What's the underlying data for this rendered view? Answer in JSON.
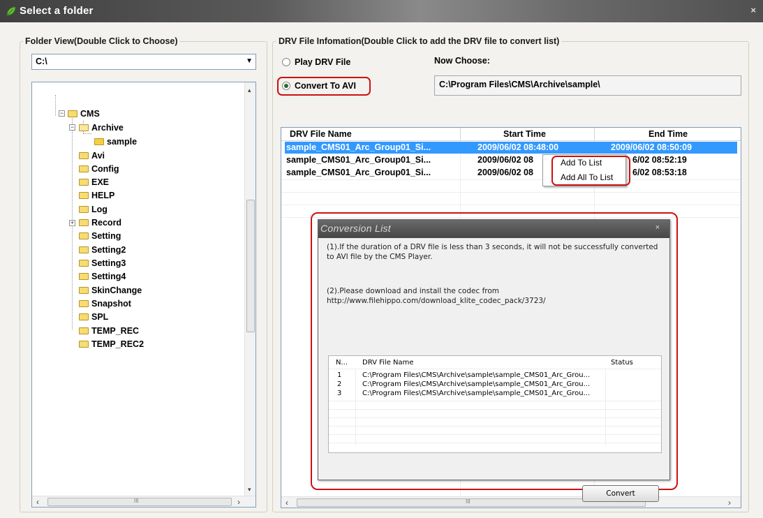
{
  "window": {
    "title": "Select a folder",
    "close_glyph": "×"
  },
  "folder_view": {
    "group_title": "Folder View(Double Click to Choose)",
    "drive_value": "C:\\",
    "tree": [
      {
        "label": "CMS"
      },
      {
        "label": "Archive"
      },
      {
        "label": "sample"
      },
      {
        "label": "Avi"
      },
      {
        "label": "Config"
      },
      {
        "label": "EXE"
      },
      {
        "label": "HELP"
      },
      {
        "label": "Log"
      },
      {
        "label": "Record"
      },
      {
        "label": "Setting"
      },
      {
        "label": "Setting2"
      },
      {
        "label": "Setting3"
      },
      {
        "label": "Setting4"
      },
      {
        "label": "SkinChange"
      },
      {
        "label": "Snapshot"
      },
      {
        "label": "SPL"
      },
      {
        "label": "TEMP_REC"
      },
      {
        "label": "TEMP_REC2"
      }
    ]
  },
  "drv_info": {
    "group_title": "DRV File Infomation(Double Click to add the DRV file to convert list)",
    "radio_play": "Play DRV File",
    "radio_convert": "Convert To AVI",
    "now_choose_label": "Now Choose:",
    "now_choose_path": "C:\\Program Files\\CMS\\Archive\\sample\\",
    "columns": [
      "DRV File Name",
      "Start Time",
      "End Time"
    ],
    "rows": [
      {
        "name": "sample_CMS01_Arc_Group01_Si...",
        "start": "2009/06/02 08:48:00",
        "end": "2009/06/02 08:50:09"
      },
      {
        "name": "sample_CMS01_Arc_Group01_Si...",
        "start": "2009/06/02 08",
        "end": "6/02 08:52:19"
      },
      {
        "name": "sample_CMS01_Arc_Group01_Si...",
        "start": "2009/06/02 08",
        "end": "6/02 08:53:18"
      }
    ]
  },
  "context_menu": {
    "items": [
      "Add To List",
      "Add All To List"
    ]
  },
  "conversion_dialog": {
    "title": "Conversion List",
    "close_glyph": "×",
    "note1_line1": "(1).If the duration of a DRV file is less than 3 seconds, it will not be successfully converted",
    "note1_line2": "to AVI file by the CMS Player.",
    "note2_line1": "(2).Please download and install the codec from",
    "note2_line2": "http://www.filehippo.com/download_klite_codec_pack/3723/",
    "columns": [
      "N...",
      "DRV File Name",
      "Status"
    ],
    "rows": [
      {
        "n": "1",
        "file": "C:\\Program Files\\CMS\\Archive\\sample\\sample_CMS01_Arc_Grou...",
        "status": ""
      },
      {
        "n": "2",
        "file": "C:\\Program Files\\CMS\\Archive\\sample\\sample_CMS01_Arc_Grou...",
        "status": ""
      },
      {
        "n": "3",
        "file": "C:\\Program Files\\CMS\\Archive\\sample\\sample_CMS01_Arc_Grou...",
        "status": ""
      }
    ],
    "convert_label": "Convert"
  },
  "scroll": {
    "left_arrow": "‹",
    "right_arrow": "›",
    "up_arrow": "▴",
    "down_arrow": "▾",
    "grip": "III"
  },
  "colors": {
    "selection": "#3399ff",
    "highlight_ring": "#cc1111"
  }
}
